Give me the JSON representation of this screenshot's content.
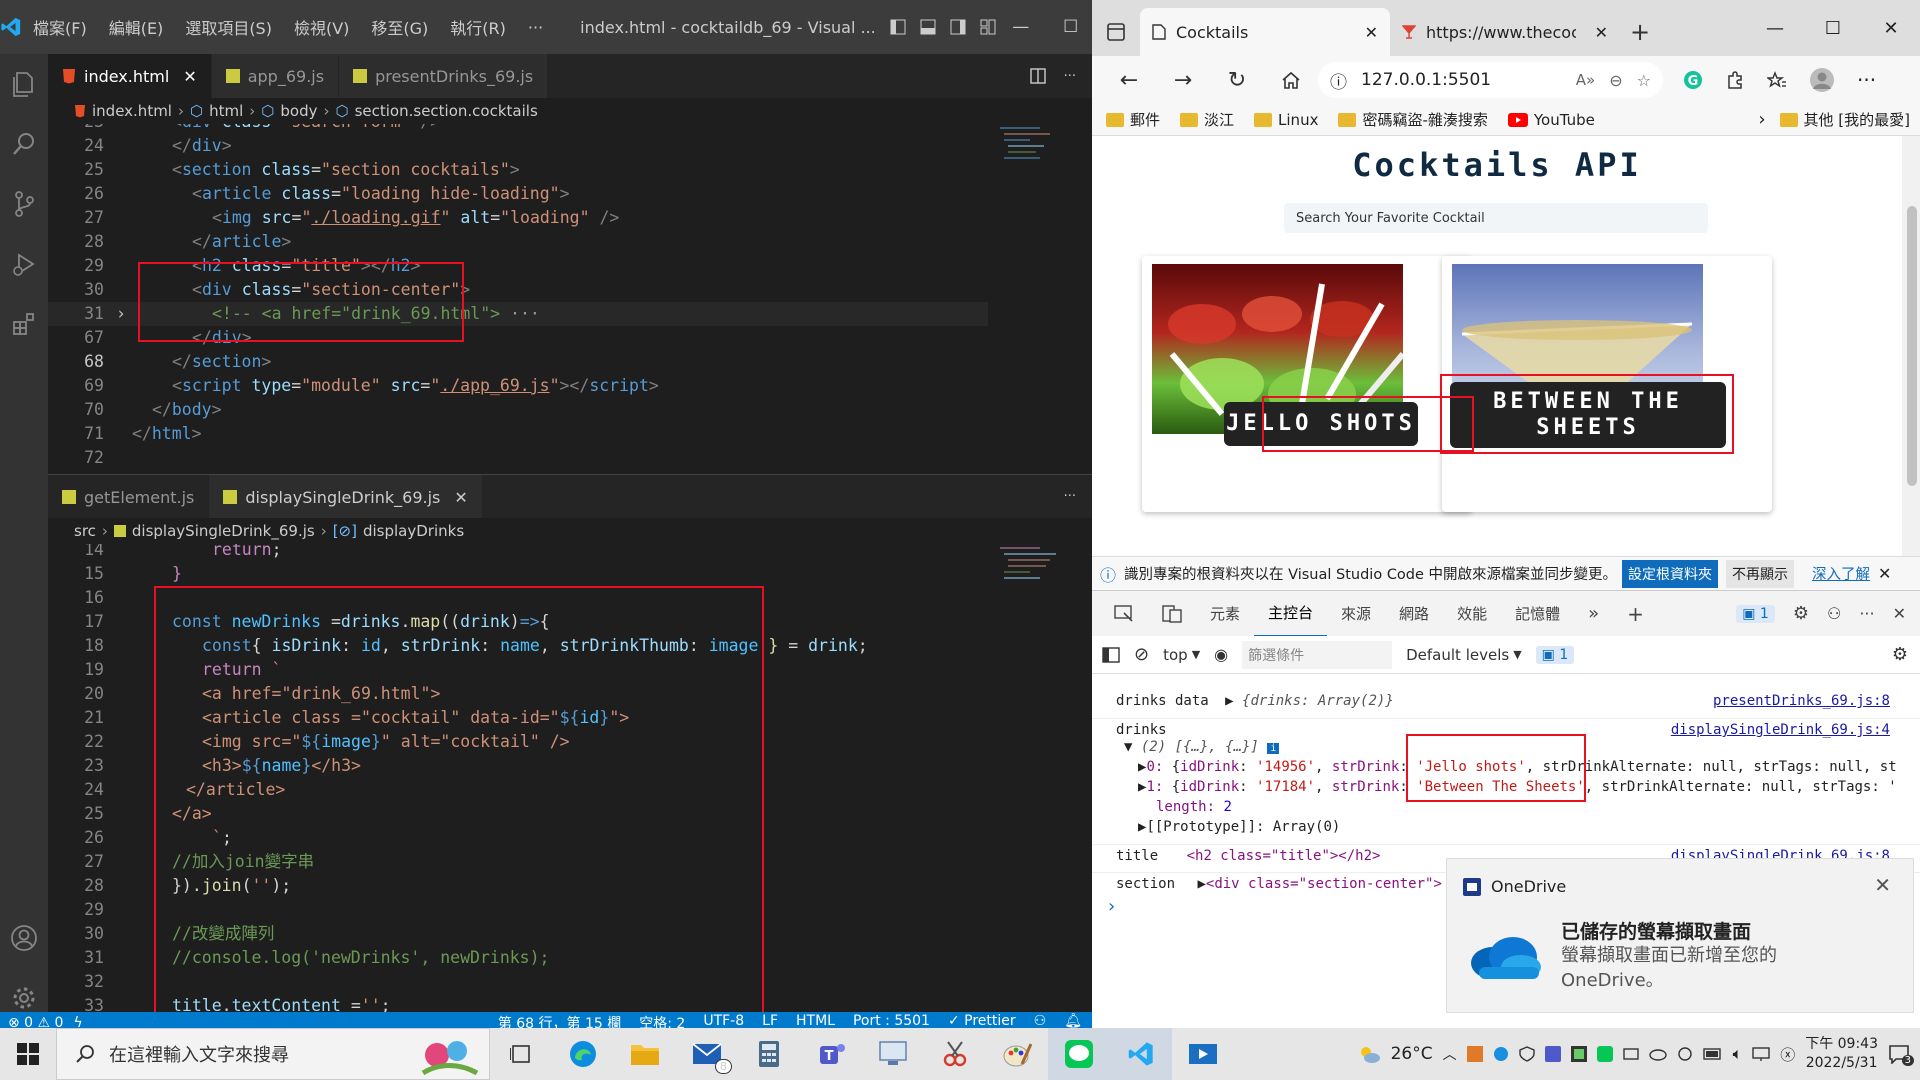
{
  "vscode": {
    "menu": [
      "檔案(F)",
      "編輯(E)",
      "選取項目(S)",
      "檢視(V)",
      "移至(G)",
      "執行(R)",
      "···"
    ],
    "window_title": "index.html - cocktaildb_69 - Visual ...",
    "top_tabs": [
      {
        "label": "index.html",
        "close": "✕"
      },
      {
        "label": "app_69.js"
      },
      {
        "label": "presentDrinks_69.js"
      }
    ],
    "top_breadcrumb": [
      "index.html",
      "html",
      "body",
      "section.section.cocktails"
    ],
    "bottom_tabs": [
      {
        "label": "getElement.js"
      },
      {
        "label": "displaySingleDrink_69.js",
        "close": "✕"
      }
    ],
    "bottom_breadcrumb": [
      "src",
      "displaySingleDrink_69.js",
      "displayDrinks"
    ],
    "fold_marker": "›",
    "statusbar": {
      "errors": "⊗ 0 ⚠ 0",
      "position": "第 68 行，第 15 欄",
      "spaces": "空格: 2",
      "encoding": "UTF-8",
      "eol": "LF",
      "language": "HTML",
      "port": "Port : 5501",
      "prettier": "✓ Prettier"
    }
  },
  "browser": {
    "tabs": [
      {
        "label": "Cocktails",
        "close": "✕"
      },
      {
        "label": "https://www.thecocktaildb",
        "close": "✕"
      }
    ],
    "new_tab": "+",
    "address": "127.0.0.1:5501",
    "favorites": [
      "郵件",
      "淡江",
      "Linux",
      "密碼竊盜-雜湊搜索",
      "YouTube"
    ],
    "other_favorites": "其他 [我的最愛]",
    "page": {
      "title": "Cocktails API",
      "search_placeholder": "Search Your Favorite Cocktail",
      "cards": [
        {
          "name": "JELLO SHOTS"
        },
        {
          "name": "BETWEEN THE SHEETS"
        }
      ]
    },
    "infobar": {
      "message": "識別專案的根資料夾以在 Visual Studio Code 中開啟來源檔案並同步變更。",
      "primary": "設定根資料夾",
      "secondary": "不再顯示",
      "link": "深入了解"
    },
    "devtools_tabs": [
      "元素",
      "主控台",
      "來源",
      "網路",
      "效能",
      "記憶體"
    ],
    "devtools_issue_badge": "1",
    "console_toolbar": {
      "context": "top",
      "filter_placeholder": "篩選條件",
      "levels": "Default levels",
      "issues": "1"
    },
    "console": {
      "l1_label": "drinks data",
      "l1_value": "{drinks: Array(2)}",
      "l1_src": "presentDrinks_69.js:8",
      "l2_label": "drinks",
      "l2_src": "displaySingleDrink_69.js:4",
      "l3": "(2) [{…}, {…}]",
      "l4_idx": "0:",
      "l4_id": "'14956'",
      "l4_drink": "'Jello shots'",
      "l4_rest": ", strDrinkAlternate: null, strTags: null, st",
      "l5_idx": "1:",
      "l5_id": "'17184'",
      "l5_drink": "'Between The Sheets'",
      "l5_rest": ", strDrinkAlternate: null, strTags: '",
      "l6_key": "length:",
      "l6_val": "2",
      "l7": "[[Prototype]]: Array(0)",
      "l8_label": "title",
      "l8_value": "<h2 class=\"title\"></h2>",
      "l8_src": "displaySingleDrink_69.js:8",
      "l9_label": "section",
      "l9_value": "<div class=\"section-center\">",
      "prompt": "›"
    }
  },
  "notification": {
    "app": "OneDrive",
    "title": "已儲存的螢幕擷取畫面",
    "body": "螢幕擷取畫面已新增至您的 OneDrive。",
    "close": "✕"
  },
  "taskbar": {
    "search_placeholder": "在這裡輸入文字來搜尋",
    "mail_badge": "8",
    "temperature": "26°C",
    "time": "下午 09:43",
    "date": "2022/5/31",
    "notification_count": "3"
  },
  "colors": {
    "vscode_bg": "#1e1e1e",
    "statusbar": "#007acc",
    "highlight_box": "#e81123",
    "cocktail_title": "#102a42"
  }
}
